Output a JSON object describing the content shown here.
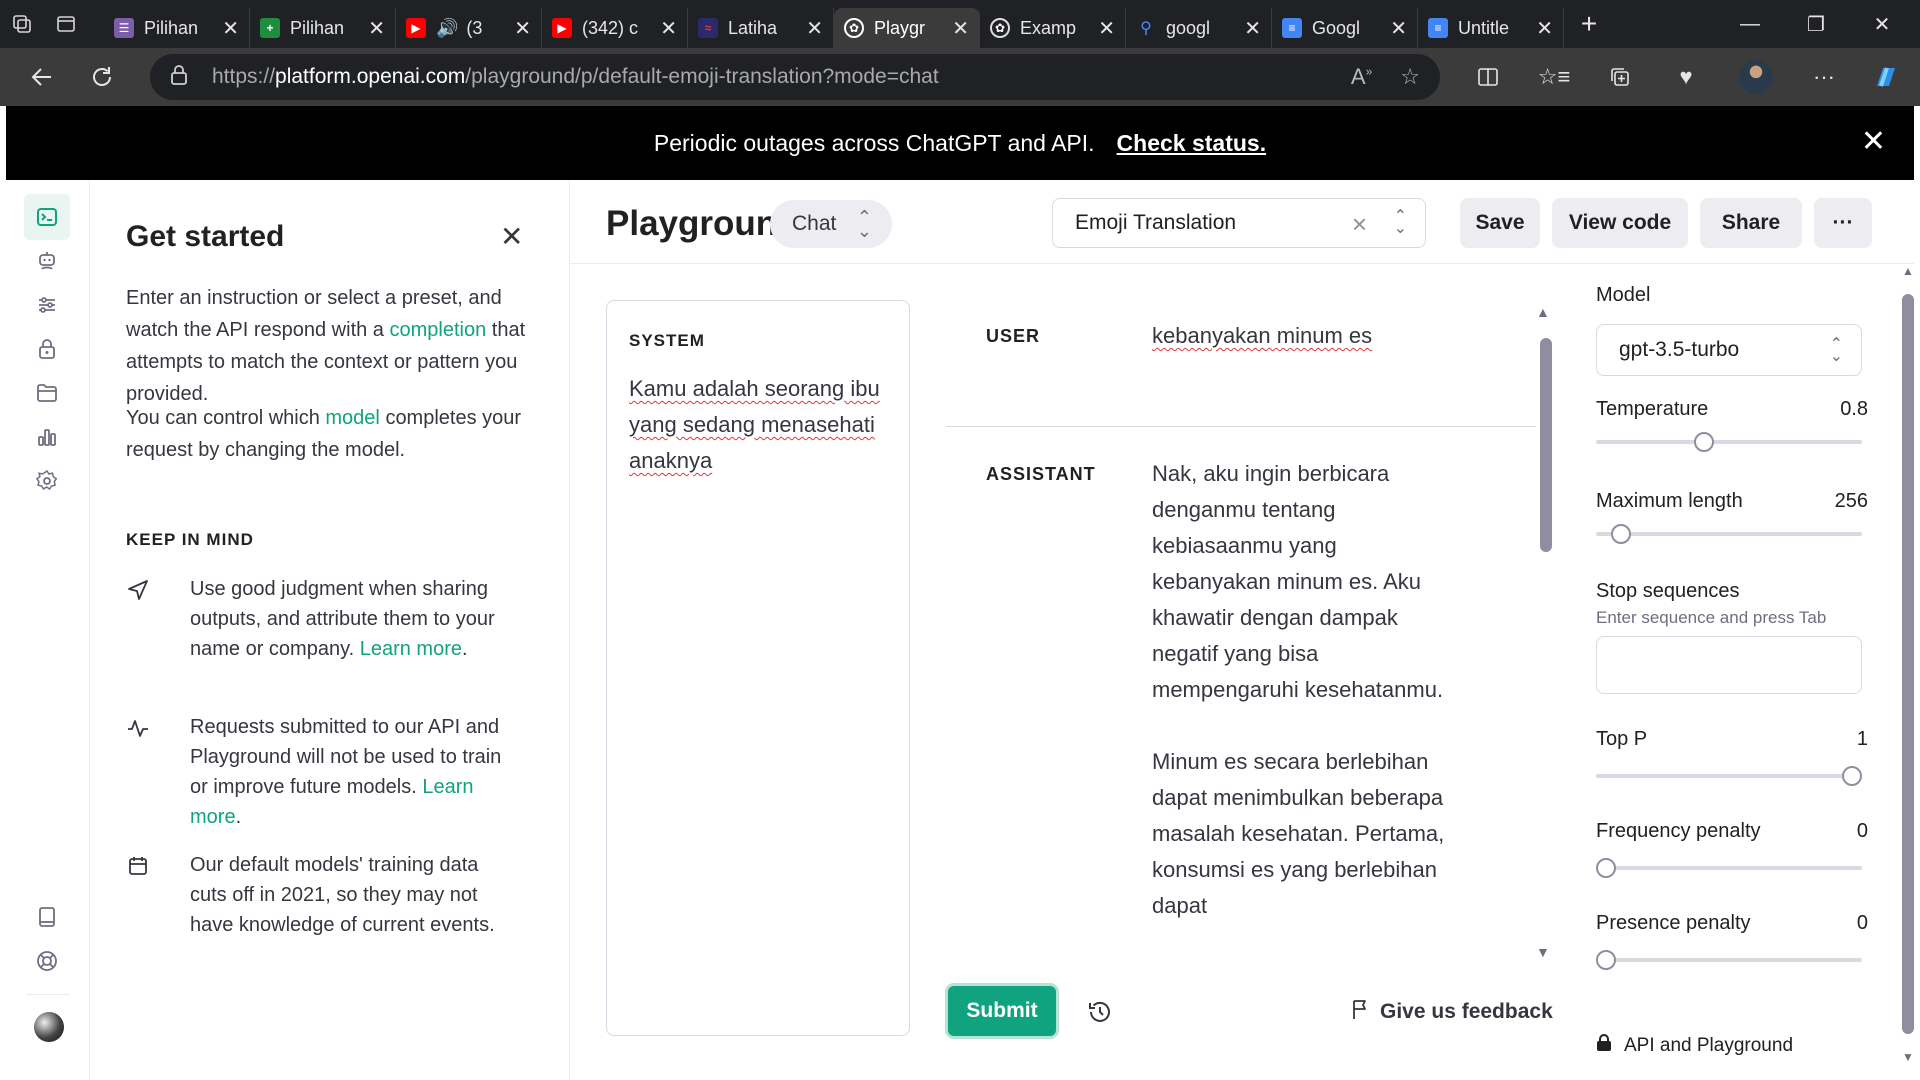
{
  "browser": {
    "tabs": [
      {
        "label": "Pilihan",
        "favicon": "purple-form-icon",
        "color": "#7b5ea7",
        "active": false
      },
      {
        "label": "Pilihan",
        "favicon": "green-sheets-icon",
        "color": "#1e8e3e",
        "active": false
      },
      {
        "label": "(3",
        "favicon": "youtube-icon",
        "color": "#ff0000",
        "active": false
      },
      {
        "label": "(342) c",
        "favicon": "youtube-icon",
        "color": "#ff0000",
        "active": false
      },
      {
        "label": "Latiha",
        "favicon": "site-icon",
        "color": "#3a5bd9",
        "active": false
      },
      {
        "label": "Playgr",
        "favicon": "openai-icon",
        "color": "#ffffff",
        "active": true
      },
      {
        "label": "Examp",
        "favicon": "openai-icon",
        "color": "#ffffff",
        "active": false
      },
      {
        "label": "googl",
        "favicon": "search-icon",
        "color": "#4c8bf5",
        "active": false
      },
      {
        "label": "Googl",
        "favicon": "docs-icon",
        "color": "#4285f4",
        "active": false
      },
      {
        "label": "Untitle",
        "favicon": "docs-icon",
        "color": "#4285f4",
        "active": false
      }
    ],
    "url_prefix": "https://",
    "url_domain": "platform.openai.com",
    "url_path": "/playground/p/default-emoji-translation?mode=chat"
  },
  "banner": {
    "text": "Periodic outages across ChatGPT and API.",
    "link": "Check status."
  },
  "get_started": {
    "title": "Get started",
    "intro_before": "Enter an instruction or select a preset, and watch the API respond with a",
    "intro_link": "completion",
    "intro_after": "that attempts to match the context or pattern you provided.",
    "model_before": "You can control which",
    "model_link": "model",
    "model_after": "completes your request by changing the model.",
    "keep_in_mind": "KEEP IN MIND",
    "items": [
      {
        "text": "Use good judgment when sharing outputs, and attribute them to your name or company.",
        "link": "Learn more",
        "suffix": "."
      },
      {
        "text": "Requests submitted to our API and Playground will not be used to train or improve future models.",
        "link": "Learn more",
        "suffix": "."
      },
      {
        "text": "Our default models' training data cuts off in 2021, so they may not have knowledge of current events.",
        "link": "",
        "suffix": ""
      }
    ]
  },
  "header": {
    "title": "Playground",
    "mode": "Chat",
    "preset": "Emoji Translation",
    "save": "Save",
    "view_code": "View code",
    "share": "Share",
    "more": "···"
  },
  "system": {
    "label": "SYSTEM",
    "text": "Kamu adalah seorang ibu yang sedang menasehati anaknya"
  },
  "messages": [
    {
      "role": "USER",
      "text": "kebanyakan minum es"
    },
    {
      "role": "ASSISTANT",
      "text": "Nak, aku ingin berbicara denganmu tentang kebiasaanmu yang kebanyakan minum es. Aku khawatir dengan dampak negatif yang bisa mempengaruhi kesehatanmu.\n\nMinum es secara berlebihan dapat menimbulkan beberapa masalah kesehatan. Pertama, konsumsi es yang berlebihan dapat"
    }
  ],
  "actions": {
    "submit": "Submit",
    "feedback": "Give us feedback"
  },
  "settings": {
    "model_label": "Model",
    "model": "gpt-3.5-turbo",
    "temperature": {
      "label": "Temperature",
      "value": "0.8",
      "fraction": 0.4
    },
    "max_length": {
      "label": "Maximum length",
      "value": "256",
      "fraction": 0.06
    },
    "stop_sequences": {
      "label": "Stop sequences",
      "hint": "Enter sequence and press Tab",
      "value": ""
    },
    "top_p": {
      "label": "Top P",
      "value": "1",
      "fraction": 1.0
    },
    "frequency_penalty": {
      "label": "Frequency penalty",
      "value": "0",
      "fraction": 0.0
    },
    "presence_penalty": {
      "label": "Presence penalty",
      "value": "0",
      "fraction": 0.0
    },
    "api_note": "API and Playground"
  },
  "colors": {
    "accent": "#10a37f",
    "banner_bg": "#000000"
  }
}
